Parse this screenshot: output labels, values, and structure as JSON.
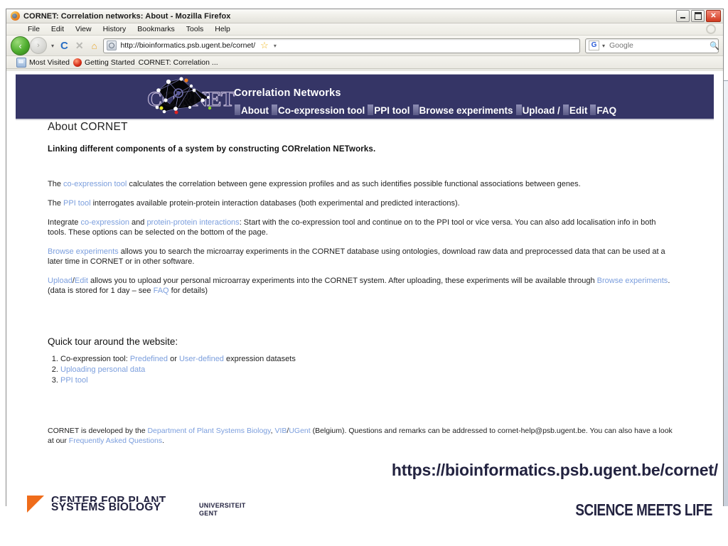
{
  "browser": {
    "title": "CORNET: Correlation networks: About - Mozilla Firefox",
    "window_buttons": {
      "minimize": "minimize-button",
      "maximize": "maximize-button",
      "close": "✕"
    },
    "menus": [
      "File",
      "Edit",
      "View",
      "History",
      "Bookmarks",
      "Tools",
      "Help"
    ],
    "toolbar": {
      "back": "‹",
      "forward": "›",
      "dropdown": "▾",
      "reload": "C",
      "stop": "✕",
      "home": "⌂"
    },
    "url": "http://bioinformatics.psb.ugent.be/cornet/",
    "star": "☆",
    "search": {
      "engine": "G",
      "placeholder": "Google",
      "magnifier": "🔎"
    },
    "bookmarks": [
      "Most Visited",
      "Getting Started",
      "CORNET: Correlation ..."
    ]
  },
  "site": {
    "logo_word": "CORNET",
    "brand_title": "Correlation Networks",
    "nav": [
      "About",
      "Co-expression tool",
      "PPI tool",
      "Browse experiments",
      "Upload /",
      "Edit",
      "FAQ"
    ],
    "colors": {
      "header_band": "#353566",
      "nav_tab": "#8e8eb4",
      "link": "#7b9edd",
      "accent_orange": "#ef6c1a",
      "dark_navy": "#232340"
    }
  },
  "main": {
    "heading": "About CORNET",
    "tagline": "Linking different components of a system by constructing CORrelation NETworks.",
    "paragraphs": [
      {
        "parts": [
          {
            "t": "The ",
            "link": false
          },
          {
            "t": "co-expression tool",
            "link": true
          },
          {
            "t": " calculates the correlation between gene expression profiles and as such identifies possible functional associations between genes.",
            "link": false
          }
        ]
      },
      {
        "parts": [
          {
            "t": "The ",
            "link": false
          },
          {
            "t": "PPI tool",
            "link": true
          },
          {
            "t": " interrogates available protein-protein interaction databases (both experimental and predicted interactions).",
            "link": false
          }
        ]
      },
      {
        "parts": [
          {
            "t": "Integrate ",
            "link": false
          },
          {
            "t": "co-expression",
            "link": true
          },
          {
            "t": " and ",
            "link": false
          },
          {
            "t": "protein-protein interactions",
            "link": true
          },
          {
            "t": ": Start with the co-expression tool and continue on to the PPI tool or vice versa. You can also add localisation info in both tools. These options can be selected on the bottom of the page.",
            "link": false
          }
        ]
      },
      {
        "parts": [
          {
            "t": "Browse experiments",
            "link": true
          },
          {
            "t": " allows you to search the microarray experiments in the CORNET database using ontologies, download raw data and preprocessed data that can be used at a later time in CORNET or in other software.",
            "link": false
          }
        ]
      },
      {
        "parts": [
          {
            "t": "Upload",
            "link": true
          },
          {
            "t": "/",
            "link": false
          },
          {
            "t": "Edit",
            "link": true
          },
          {
            "t": " allows you to upload your personal microarray experiments into the CORNET system. After uploading, these experiments will be available through ",
            "link": false
          },
          {
            "t": "Browse experiments",
            "link": true
          },
          {
            "t": ". (data is stored for 1 day – see ",
            "link": false
          },
          {
            "t": "FAQ",
            "link": true
          },
          {
            "t": " for details)",
            "link": false
          }
        ]
      }
    ],
    "quick_tour_heading": "Quick tour around the website:",
    "tour_items": [
      {
        "parts": [
          {
            "t": "Co-expression tool: ",
            "link": false
          },
          {
            "t": "Predefined",
            "link": true
          },
          {
            "t": " or ",
            "link": false
          },
          {
            "t": "User-defined",
            "link": true
          },
          {
            "t": " expression datasets",
            "link": false
          }
        ]
      },
      {
        "parts": [
          {
            "t": "Uploading personal data",
            "link": true
          }
        ]
      },
      {
        "parts": [
          {
            "t": "PPI tool",
            "link": true
          }
        ]
      }
    ],
    "footer": {
      "parts": [
        {
          "t": "CORNET is developed by the ",
          "link": false
        },
        {
          "t": "Department of Plant Systems Biology",
          "link": true
        },
        {
          "t": ", ",
          "link": false
        },
        {
          "t": "VIB",
          "link": true
        },
        {
          "t": "/",
          "link": false
        },
        {
          "t": "UGent",
          "link": true
        },
        {
          "t": " (Belgium). Questions and remarks can be addressed to cornet-help@psb.ugent.be. You can also have a look at our ",
          "link": false
        },
        {
          "t": "Frequently Asked Questions",
          "link": true
        },
        {
          "t": ".",
          "link": false
        }
      ]
    }
  },
  "slide": {
    "big_url": "https://bioinformatics.psb.ugent.be/cornet/",
    "vib_logo_line1": "CENTER FOR PLANT",
    "vib_logo_line2": "SYSTEMS BIOLOGY",
    "ugent_line1": "UNIVERSITEIT",
    "ugent_line2": "GENT",
    "tagline": "SCIENCE MEETS LIFE"
  }
}
